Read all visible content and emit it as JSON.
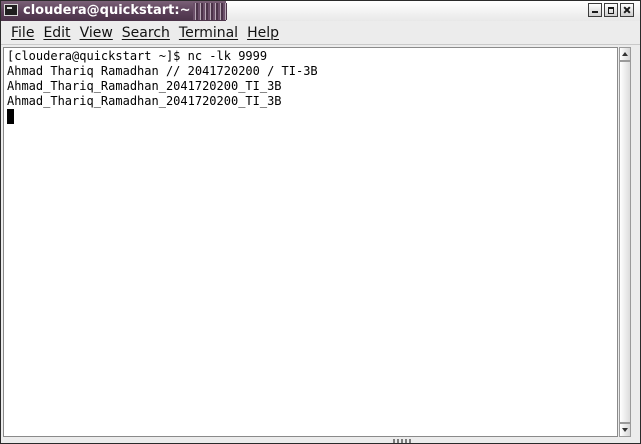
{
  "window": {
    "title": "cloudera@quickstart:~",
    "icon": "terminal-icon",
    "buttons": [
      "minimize-icon",
      "maximize-icon",
      "close-icon"
    ]
  },
  "menu": {
    "items": [
      "File",
      "Edit",
      "View",
      "Search",
      "Terminal",
      "Help"
    ]
  },
  "terminal": {
    "lines": [
      "[cloudera@quickstart ~]$ nc -lk 9999",
      "Ahmad Thariq Ramadhan // 2041720200 / TI-3B",
      "Ahmad_Thariq_Ramadhan_2041720200_TI_3B",
      "Ahmad_Thariq_Ramadhan_2041720200_TI_3B"
    ]
  }
}
